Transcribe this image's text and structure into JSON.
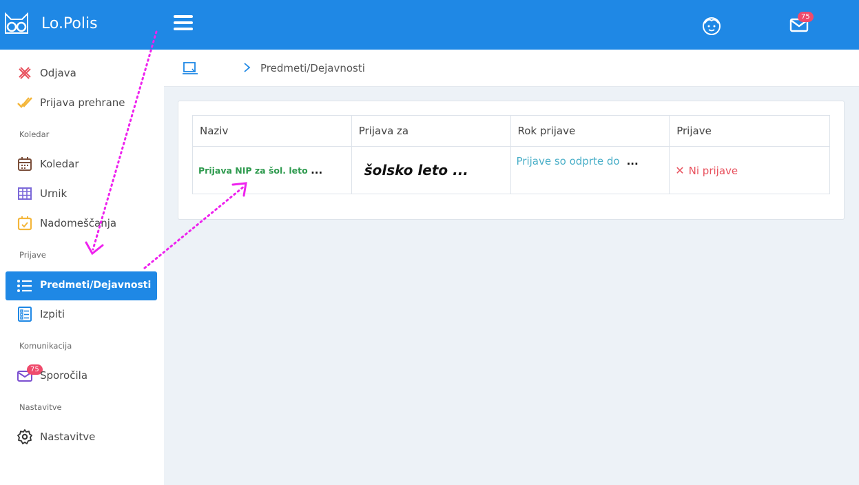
{
  "app": {
    "name": "Lo.Polis",
    "logo": "owl-logo"
  },
  "header": {
    "menu_icon": "hamburger-icon",
    "profile_icon": "face-icon",
    "messages_icon": "mail-icon",
    "messages_badge": "75"
  },
  "sidebar": {
    "items": [
      {
        "label": "Odjava",
        "icon": "plate-cross-icon"
      },
      {
        "label": "Prijava prehrane",
        "icon": "double-check-icon"
      },
      {
        "section": "Koledar"
      },
      {
        "label": "Koledar",
        "icon": "calendar-icon"
      },
      {
        "label": "Urnik",
        "icon": "grid-icon"
      },
      {
        "label": "Nadomeščanja",
        "icon": "calendar-check-icon"
      },
      {
        "section": "Prijave"
      },
      {
        "label": "Predmeti/Dejavnosti",
        "icon": "list-icon",
        "active": true
      },
      {
        "label": "Izpiti",
        "icon": "checklist-icon"
      },
      {
        "section": "Komunikacija"
      },
      {
        "label": "Sporočila",
        "icon": "mail-icon",
        "badge": "75"
      },
      {
        "section": "Nastavitve"
      },
      {
        "label": "Nastavitve",
        "icon": "gear-icon"
      }
    ]
  },
  "breadcrumb": {
    "home_icon": "board-icon",
    "current": "Predmeti/Dejavnosti"
  },
  "table": {
    "headers": [
      "Naziv",
      "Prijava za",
      "Rok prijave",
      "Prijave"
    ],
    "rows": [
      {
        "naziv": "Prijava NIP za šol. leto",
        "naziv_more": "...",
        "prijava_za": "šolsko leto ...",
        "rok_prijave": "Prijave so odprte do",
        "rok_more": "...",
        "prijave": "Ni prijave"
      }
    ]
  },
  "colors": {
    "primary": "#1f88e5",
    "badge": "#ef4b6c",
    "success": "#2e9a4e",
    "link": "#4aafc8",
    "danger": "#e8515d",
    "annotation": "#ee22ee"
  }
}
